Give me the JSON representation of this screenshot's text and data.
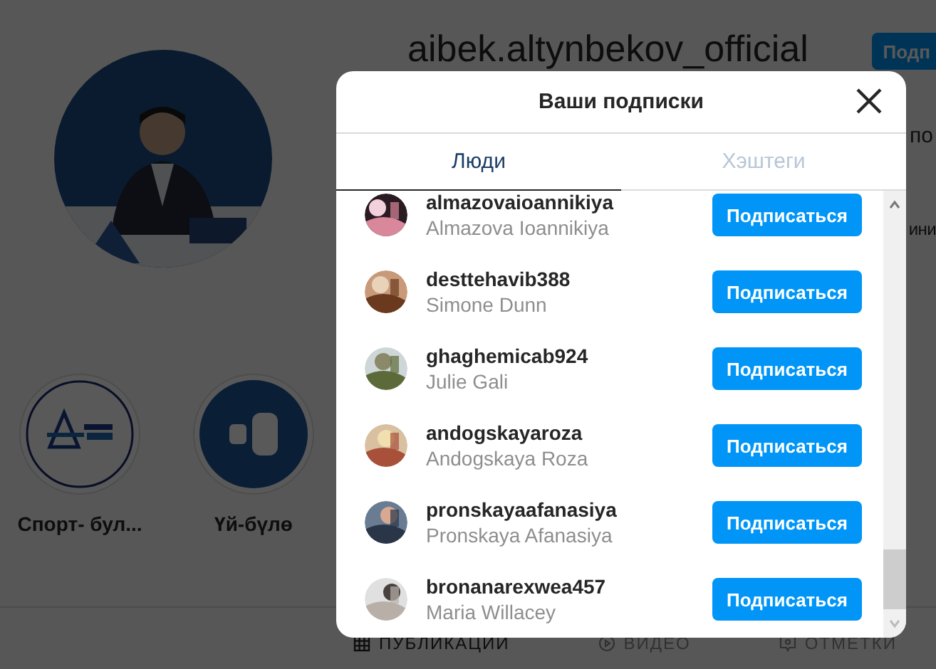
{
  "profile": {
    "username": "aibek.altynbekov_official",
    "follow_button": "Подп",
    "side_texts": [
      "по",
      "ини"
    ]
  },
  "highlights": [
    {
      "label": "Спорт- бул..."
    },
    {
      "label": "Үй-бүлө"
    }
  ],
  "profile_tabs": [
    {
      "label": "ПУБЛИКАЦИИ",
      "selected": true
    },
    {
      "label": "ВИДЕО",
      "selected": false
    },
    {
      "label": "ОТМЕТКИ",
      "selected": false
    }
  ],
  "modal": {
    "title": "Ваши подписки",
    "tabs": [
      {
        "label": "Люди",
        "selected": true
      },
      {
        "label": "Хэштеги",
        "selected": false
      }
    ],
    "accounts": [
      {
        "username": "almazovaioannikiya",
        "name": "Almazova Ioannikiya",
        "button": "Подписаться"
      },
      {
        "username": "desttehavib388",
        "name": "Simone Dunn",
        "button": "Подписаться"
      },
      {
        "username": "ghaghemicab924",
        "name": "Julie Gali",
        "button": "Подписаться"
      },
      {
        "username": "andogskayaroza",
        "name": "Andogskaya Roza",
        "button": "Подписаться"
      },
      {
        "username": "pronskayaafanasiya",
        "name": "Pronskaya Afanasiya",
        "button": "Подписаться"
      },
      {
        "username": "bronanarexwea457",
        "name": "Maria Willacey",
        "button": "Подписаться"
      }
    ]
  }
}
